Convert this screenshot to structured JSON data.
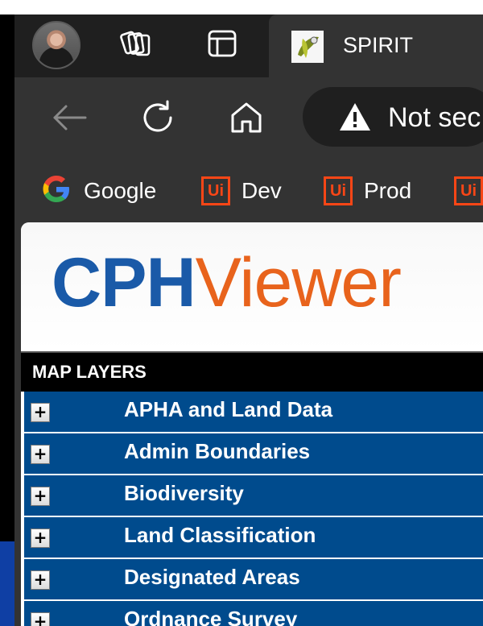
{
  "tab": {
    "title": "SPIRIT"
  },
  "address": {
    "security_label": "Not sec"
  },
  "bookmarks": [
    {
      "label": "Google",
      "icon": "google-icon"
    },
    {
      "label": "Dev",
      "icon": "uipath-icon"
    },
    {
      "label": "Prod",
      "icon": "uipath-icon"
    },
    {
      "label": "",
      "icon": "uipath-icon"
    }
  ],
  "logo": {
    "part1": "CPH",
    "part2": "Viewer"
  },
  "layers": {
    "header": "MAP LAYERS",
    "expand_symbol": "+",
    "items": [
      "APHA and Land Data",
      "Admin Boundaries",
      "Biodiversity",
      "Land Classification",
      "Designated Areas",
      "Ordnance Survey"
    ]
  },
  "colors": {
    "titlebar": "#1f1f1f",
    "toolbar": "#333333",
    "layer_row": "#004b8d",
    "logo_blue": "#1a5aa8",
    "logo_orange": "#e8631c",
    "uipath_orange": "#fa4616"
  }
}
